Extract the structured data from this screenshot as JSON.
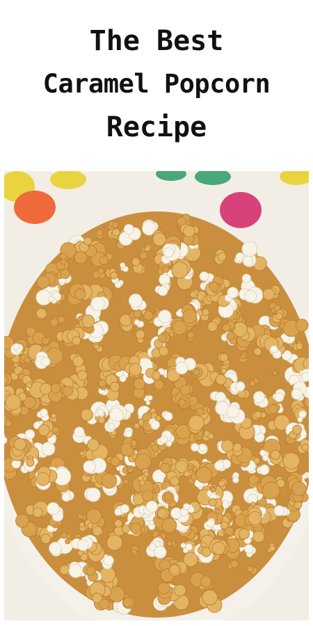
{
  "title": {
    "line1": "The Best",
    "line2": "Caramel Popcorn",
    "line3": "Recipe"
  },
  "photo": {
    "subject": "caramel-popcorn-bowl",
    "colors": {
      "bowl_rim": "#f4f1ea",
      "caramel": "#d9a24e",
      "caramel_dark": "#b97d2c",
      "popcorn_white": "#f7f3e6",
      "napkin_yellow": "#e9d43f",
      "napkin_orange": "#ee6a3a",
      "napkin_pink": "#d7427a",
      "napkin_green": "#49a87a"
    }
  }
}
